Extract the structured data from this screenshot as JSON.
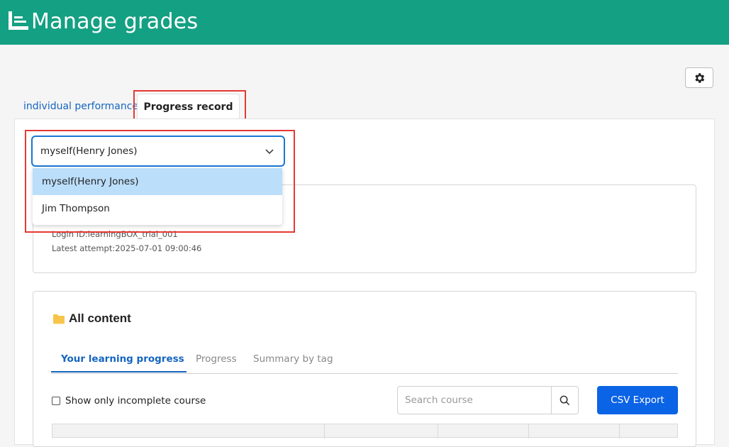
{
  "header": {
    "title": "Manage grades",
    "logo_icon": "list-chart-logo-icon",
    "background_color": "#14a083"
  },
  "toolbar": {
    "settings_icon": "gear-icon"
  },
  "top_tabs": [
    {
      "label": "individual performance",
      "active": false
    },
    {
      "label": "Progress record",
      "active": true
    }
  ],
  "user_select": {
    "value": "myself(Henry Jones)",
    "options": [
      "myself(Henry Jones)",
      "Jim Thompson"
    ],
    "highlighted_index": 0
  },
  "user_info": {
    "login_id": "Login ID:learningBOX_trial_001",
    "latest_attempt": "Latest attempt:2025-07-01 09:00:46"
  },
  "content_section": {
    "title": "All content",
    "icon": "folder-icon",
    "tabs": [
      {
        "label": "Your learning progress",
        "active": true
      },
      {
        "label": "Progress",
        "active": false
      },
      {
        "label": "Summary by tag",
        "active": false
      }
    ],
    "filter_label": "Show only incomplete course",
    "search_placeholder": "Search course",
    "csv_button": "CSV Export"
  },
  "colors": {
    "accent": "#1565c0",
    "highlight_outline": "#e53935",
    "primary_button": "#0b63e5"
  }
}
